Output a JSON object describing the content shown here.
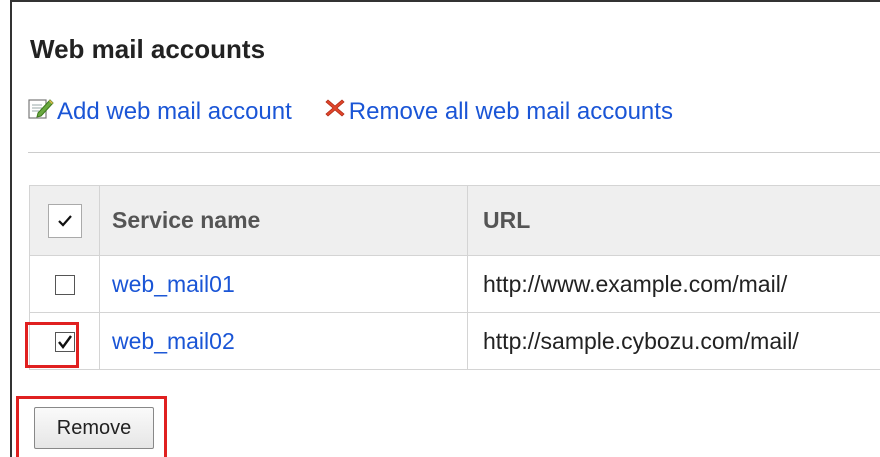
{
  "page": {
    "title": "Web mail accounts"
  },
  "actions": {
    "add_label": "Add web mail account",
    "remove_all_label": "Remove all web mail accounts"
  },
  "table": {
    "header_checked": true,
    "columns": [
      "Service name",
      "URL"
    ],
    "rows": [
      {
        "service_name": "web_mail01",
        "url": "http://www.example.com/mail/",
        "checked": false
      },
      {
        "service_name": "web_mail02",
        "url": "http://sample.cybozu.com/mail/",
        "checked": true
      }
    ]
  },
  "footer": {
    "remove_label": "Remove"
  },
  "colors": {
    "link": "#1a55d6",
    "highlight": "#e02020",
    "header_bg": "#efefef"
  },
  "icons": {
    "add": "edit-pencil-icon",
    "remove_all": "red-x-icon"
  }
}
